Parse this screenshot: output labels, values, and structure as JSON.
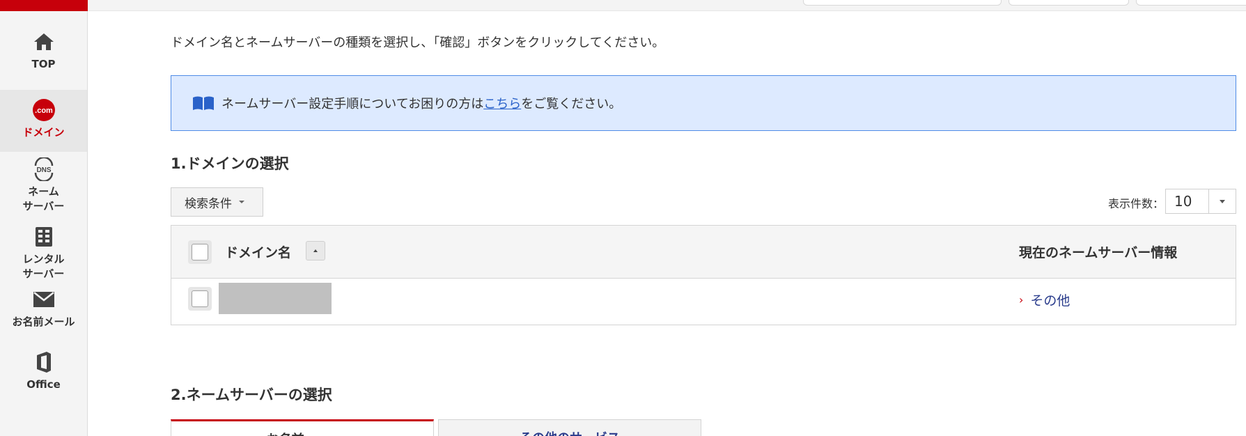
{
  "sidebar": {
    "items": [
      {
        "label": "TOP",
        "icon": "home-icon"
      },
      {
        "label": ".com",
        "sublabel": "ドメイン",
        "icon": "dotcom-icon",
        "active": true
      },
      {
        "label": "DNS",
        "sublabel_line1": "ネーム",
        "sublabel_line2": "サーバー",
        "icon": "dns-icon"
      },
      {
        "label_line1": "レンタル",
        "label_line2": "サーバー",
        "icon": "server-icon"
      },
      {
        "label": "お名前メール",
        "icon": "mail-icon"
      },
      {
        "label": "Office",
        "icon": "office-icon"
      }
    ]
  },
  "main": {
    "intro": "ドメイン名とネームサーバーの種類を選択し、「確認」ボタンをクリックしてください。",
    "notice": {
      "before": "ネームサーバー設定手順についてお困りの方は",
      "link": "こちら",
      "after": "をご覧ください。"
    },
    "section1_title": "1.ドメインの選択",
    "search_label": "検索条件",
    "count_label": "表示件数：",
    "count_value": "10",
    "table": {
      "col_domain": "ドメイン名",
      "col_ns": "現在のネームサーバー情報",
      "rows": [
        {
          "domain": "",
          "ns": "その他"
        }
      ]
    },
    "section2_title": "2.ネームサーバーの選択",
    "tabs": [
      "お名前.com",
      "その他のサービス"
    ]
  },
  "colors": {
    "brand": "#c7000b",
    "notice_bg": "#ddeaff",
    "notice_border": "#4f8ce6",
    "link": "#2a62c9"
  }
}
